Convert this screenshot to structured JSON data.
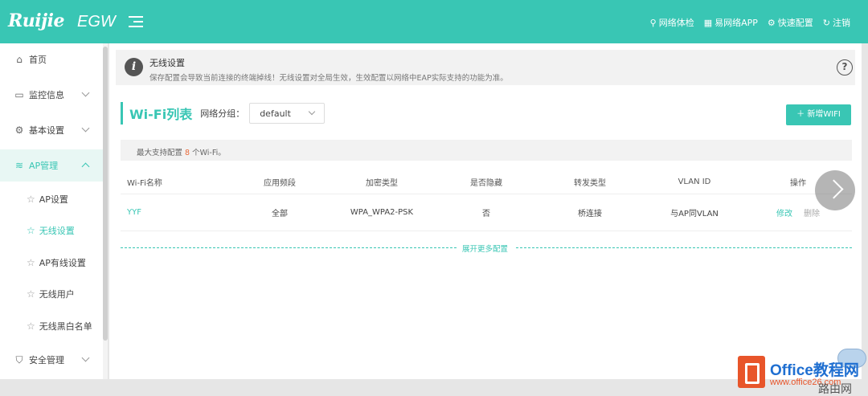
{
  "brand": {
    "logo": "Ruijie",
    "product": "EGW"
  },
  "top_links": [
    {
      "icon": "gauge-icon",
      "label": "网络体检"
    },
    {
      "icon": "app-icon",
      "label": "易网络APP"
    },
    {
      "icon": "settings-icon",
      "label": "快速配置"
    },
    {
      "icon": "logout-icon",
      "label": "注销"
    }
  ],
  "sidebar": {
    "items": [
      {
        "label": "首页",
        "icon": "home-icon"
      },
      {
        "label": "监控信息",
        "icon": "monitor-icon"
      },
      {
        "label": "基本设置",
        "icon": "gear-icon"
      },
      {
        "label": "AP管理",
        "icon": "wifi-icon"
      }
    ],
    "sub_items": [
      {
        "label": "AP设置"
      },
      {
        "label": "无线设置"
      },
      {
        "label": "AP有线设置"
      },
      {
        "label": "无线用户"
      },
      {
        "label": "无线黑白名单"
      }
    ],
    "last_item": {
      "label": "安全管理",
      "icon": "shield-icon"
    }
  },
  "notice": {
    "title": "无线设置",
    "text": "保存配置会导致当前连接的终端掉线！无线设置对全局生效，生效配置以网络中EAP实际支持的功能为准。",
    "help": "?"
  },
  "list": {
    "title": "Wi-Fi列表",
    "group_label": "网络分组：",
    "group_value": "default",
    "add_button": "＋ 新增WIFI",
    "max_prefix": "最大支持配置 ",
    "max_count": "8",
    "max_suffix": " 个Wi-Fi。"
  },
  "table": {
    "headers": [
      "Wi-Fi名称",
      "应用频段",
      "加密类型",
      "是否隐藏",
      "转发类型",
      "VLAN ID",
      "操作"
    ],
    "rows": [
      {
        "name": "YYF",
        "band": "全部",
        "encryption": "WPA_WPA2-PSK",
        "hidden": "否",
        "forward": "桥连接",
        "vlan": "与AP同VLAN",
        "edit": "修改",
        "delete": "删除"
      }
    ]
  },
  "more": "展开更多配置",
  "watermark": {
    "text": "Office教程网",
    "url": "www.office26.com",
    "corner": "路由网"
  },
  "colors": {
    "accent": "#39c6b4",
    "highlight_number": "#e96a3a"
  }
}
